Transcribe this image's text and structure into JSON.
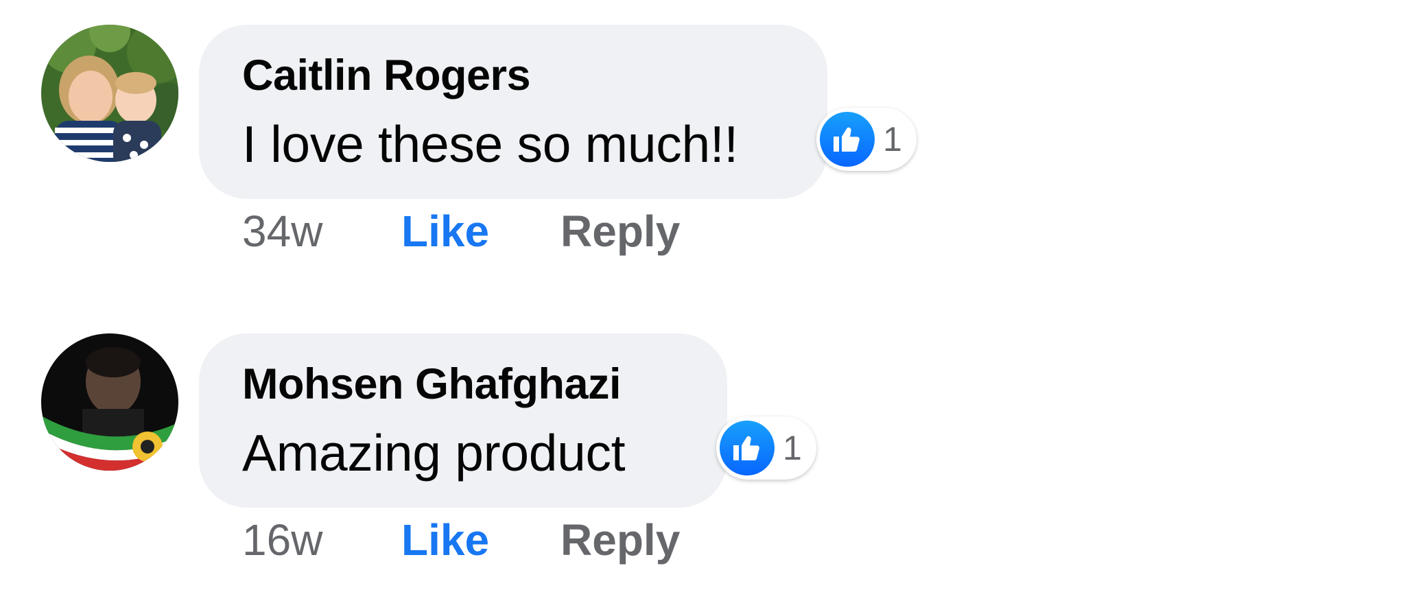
{
  "comments": [
    {
      "author": "Caitlin Rogers",
      "text": "I love these so much!!",
      "reaction_count": "1",
      "timestamp": "34w",
      "like_label": "Like",
      "reply_label": "Reply",
      "avatar_icon": "user-photo-avatar"
    },
    {
      "author": "Mohsen Ghafghazi",
      "text": "Amazing product",
      "reaction_count": "1",
      "timestamp": "16w",
      "like_label": "Like",
      "reply_label": "Reply",
      "avatar_icon": "user-photo-avatar"
    }
  ],
  "reaction_icon": "thumbs-up-icon",
  "colors": {
    "bubble": "#eff1f4",
    "like_blue": "#1877f2",
    "secondary_text": "#65676b",
    "primary_text": "#050505"
  }
}
